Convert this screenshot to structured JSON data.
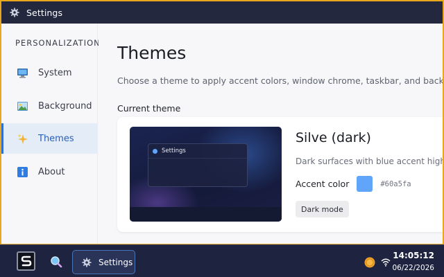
{
  "window": {
    "title": "Settings",
    "icon": "gear-icon"
  },
  "sidebar": {
    "section_label": "PERSONALIZATION",
    "items": [
      {
        "label": "System",
        "icon": "monitor-icon",
        "active": false
      },
      {
        "label": "Background",
        "icon": "image-icon",
        "active": false
      },
      {
        "label": "Themes",
        "icon": "sparkle-icon",
        "active": true
      },
      {
        "label": "About",
        "icon": "info-icon",
        "active": false
      }
    ]
  },
  "main": {
    "title": "Themes",
    "description": "Choose a theme to apply accent colors, window chrome, taskbar, and background",
    "current_theme_heading": "Current theme",
    "theme": {
      "preview_window_title": "Settings",
      "name": "Silve (dark)",
      "description": "Dark surfaces with blue accent highlig",
      "accent_label": "Accent color",
      "accent_hex": "#60a5fa",
      "mode_badge": "Dark mode"
    }
  },
  "taskbar": {
    "start_icon": "s-logo-icon",
    "search_icon": "search-icon",
    "running_app": {
      "label": "Settings",
      "icon": "gear-icon"
    },
    "tray": {
      "coin_icon": "coin-icon",
      "wifi_icon": "wifi-icon",
      "time": "14:05:12",
      "date": "06/22/2026"
    }
  },
  "colors": {
    "accent": "#60a5fa",
    "titlebar": "#23283f",
    "taskbar": "#1e2440",
    "desktop_frame": "#e9a81c",
    "nav_active_text": "#2760b9"
  }
}
